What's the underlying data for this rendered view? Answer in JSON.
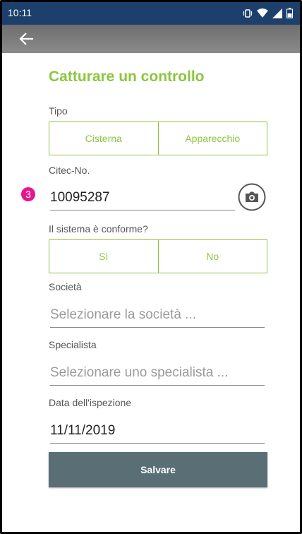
{
  "status_bar": {
    "time": "10:11",
    "icons": [
      "vibrate-icon",
      "wifi-icon",
      "signal-icon",
      "battery-icon"
    ]
  },
  "app_bar": {
    "back_icon": "arrow-left-icon"
  },
  "form": {
    "title": "Catturare un controllo",
    "tipo": {
      "label": "Tipo",
      "options": [
        "Cisterna",
        "Apparecchio"
      ]
    },
    "citec": {
      "label": "Citec-No.",
      "badge": "3",
      "value": "10095287",
      "camera_icon": "camera-icon"
    },
    "conforme": {
      "label": "Il sistema è conforme?",
      "options": [
        "Sì",
        "No"
      ]
    },
    "societa": {
      "label": "Società",
      "placeholder": "Selezionare la società ..."
    },
    "specialista": {
      "label": "Specialista",
      "placeholder": "Selezionare uno specialista ..."
    },
    "data": {
      "label": "Data dell'ispezione",
      "value": "11/11/2019"
    },
    "save_label": "Salvare"
  },
  "colors": {
    "accent": "#8cc63f",
    "status_bar": "#1d3f6b",
    "app_bar": "#7a7a7a",
    "button": "#5a6e76",
    "badge": "#e6168f"
  }
}
